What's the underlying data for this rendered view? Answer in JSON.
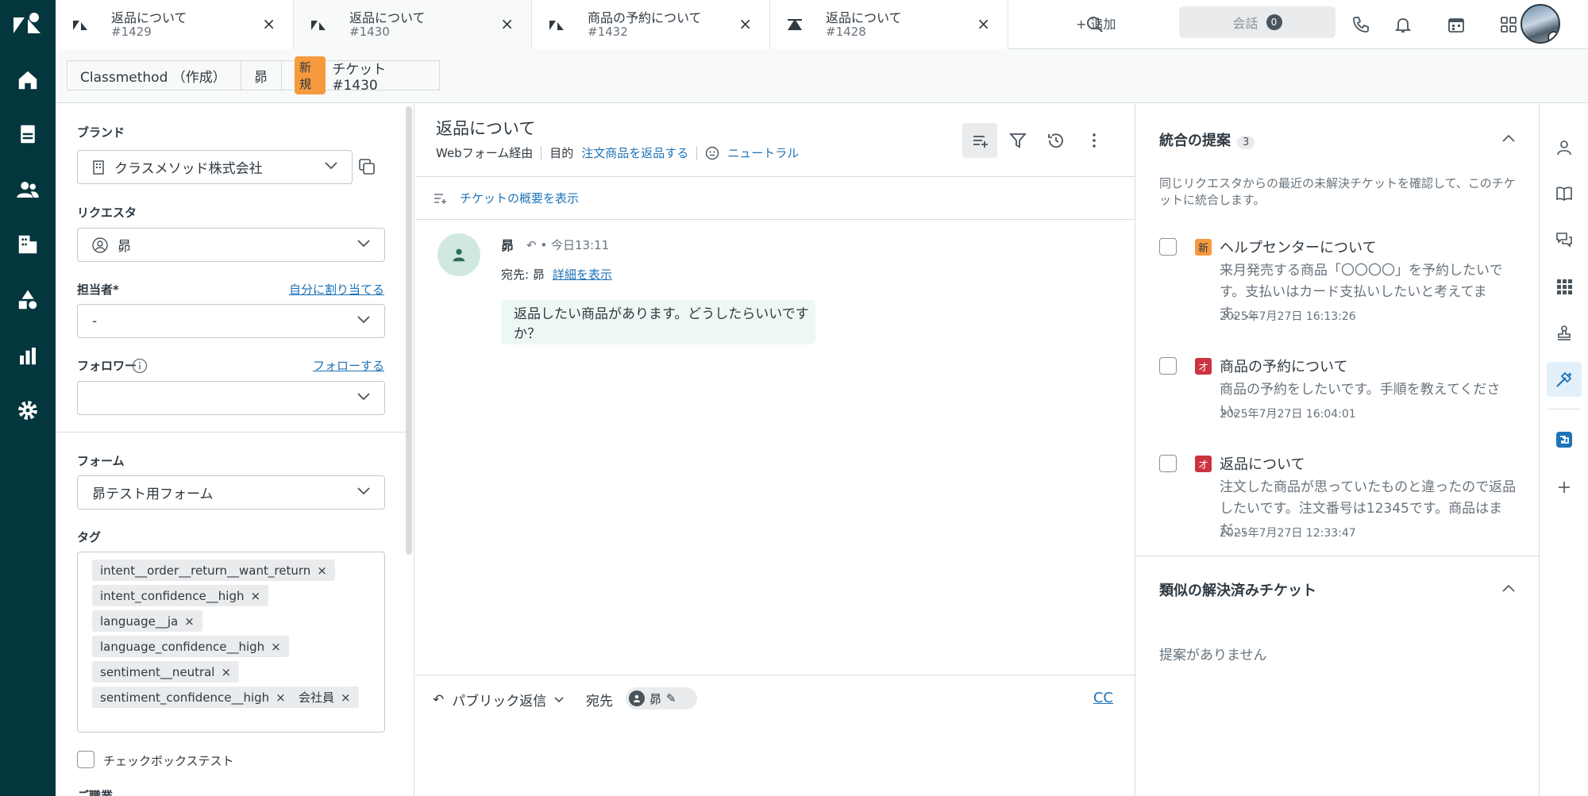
{
  "tabs": [
    {
      "title": "返品について",
      "number": "#1429"
    },
    {
      "title": "返品について",
      "number": "#1430"
    },
    {
      "title": "商品の予約について",
      "number": "#1432"
    },
    {
      "title": "返品について",
      "number": "#1428"
    }
  ],
  "topbar": {
    "add_label": "追加",
    "conversations_label": "会話",
    "conversations_count": "0"
  },
  "breadcrumb": {
    "org": "Classmethod （作成）",
    "requester": "昴",
    "status_badge": "新規",
    "ticket": "チケット #1430"
  },
  "left": {
    "brand_label": "ブランド",
    "brand_value": "クラスメソッド株式会社",
    "requester_label": "リクエスタ",
    "requester_value": "昴",
    "assignee_label": "担当者*",
    "assign_self_link": "自分に割り当てる",
    "assignee_value": "-",
    "followers_label": "フォロワー",
    "follow_link": "フォローする",
    "form_label": "フォーム",
    "form_value": "昴テスト用フォーム",
    "tags_label": "タグ",
    "tags": [
      "intent__order__return__want_return",
      "intent_confidence__high",
      "language__ja",
      "language_confidence__high",
      "sentiment__neutral",
      "sentiment_confidence__high",
      "会社員"
    ],
    "checkbox_label": "チェックボックステスト",
    "next_field_partial": "ご職業"
  },
  "ticket": {
    "title": "返品について",
    "channel": "Webフォーム経由",
    "purpose_label": "目的",
    "purpose_value": "注文商品を返品する",
    "sentiment": "ニュートラル",
    "summary_link": "チケットの概要を表示"
  },
  "message": {
    "author": "昴",
    "time": "今日13:11",
    "to_label": "宛先:",
    "to_value": "昴",
    "details_link": "詳細を表示",
    "body": "返品したい商品があります。どうしたらいいですか？"
  },
  "composer": {
    "reply_type": "パブリック返信",
    "recipient_label": "宛先",
    "recipient": "昴",
    "cc": "CC"
  },
  "merge": {
    "title": "統合の提案",
    "count": "3",
    "description": "同じリクエスタからの最近の未解決チケットを確認して、このチケットに統合します。",
    "items": [
      {
        "badge": "新",
        "title": "ヘルプセンターについて",
        "desc": "来月発売する商品「〇〇〇〇」を予約したいです。支払いはカード支払いしたいと考えてます。…",
        "date": "2025年7月27日 16:13:26"
      },
      {
        "badge": "オ",
        "title": "商品の予約について",
        "desc": "商品の予約をしたいです。手順を教えてください。",
        "date": "2025年7月27日 16:04:01"
      },
      {
        "badge": "オ",
        "title": "返品について",
        "desc": "注文した商品が思っていたものと違ったので返品したいです。注文番号は12345です。商品はまだ…",
        "date": "2025年7月27日 12:33:47"
      }
    ]
  },
  "similar": {
    "title": "類似の解決済みチケット",
    "empty": "提案がありません"
  },
  "colors": {
    "nav_bg": "#03363d",
    "new_badge": "#f79a3e",
    "open_badge": "#cc3340",
    "link": "#1f73b7",
    "message_bg": "#edf8f4"
  }
}
